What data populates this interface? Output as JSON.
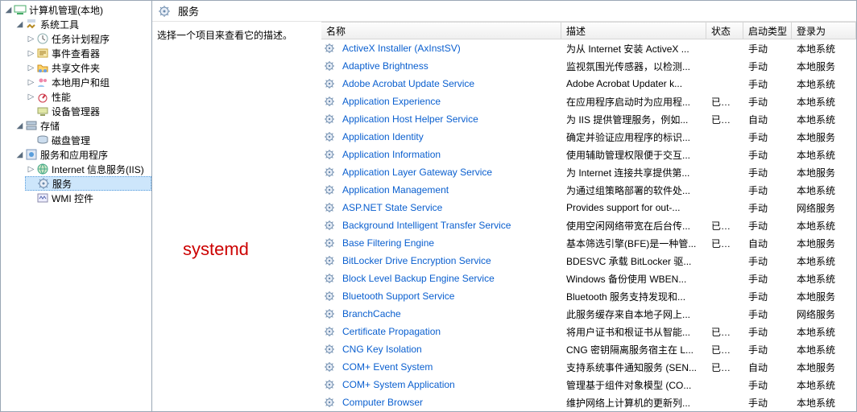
{
  "tree": {
    "root": {
      "label": "计算机管理(本地)"
    },
    "sysTools": {
      "label": "系统工具"
    },
    "taskSched": {
      "label": "任务计划程序"
    },
    "eventViewer": {
      "label": "事件查看器"
    },
    "sharedFold": {
      "label": "共享文件夹"
    },
    "localUsers": {
      "label": "本地用户和组"
    },
    "perf": {
      "label": "性能"
    },
    "devMgr": {
      "label": "设备管理器"
    },
    "storage": {
      "label": "存储"
    },
    "diskMgmt": {
      "label": "磁盘管理"
    },
    "svcApps": {
      "label": "服务和应用程序"
    },
    "iis": {
      "label": "Internet 信息服务(IIS)"
    },
    "services": {
      "label": "服务"
    },
    "wmi": {
      "label": "WMI 控件"
    }
  },
  "headerTitle": "服务",
  "detailPrompt": "选择一个项目来查看它的描述。",
  "annotation": "systemd",
  "columns": {
    "name": "名称",
    "desc": "描述",
    "status": "状态",
    "startup": "启动类型",
    "logon": "登录为"
  },
  "services": [
    {
      "name": "ActiveX Installer (AxInstSV)",
      "desc": "为从 Internet 安装 ActiveX ...",
      "status": "",
      "startup": "手动",
      "logon": "本地系统"
    },
    {
      "name": "Adaptive Brightness",
      "desc": "监视氛围光传感器，以检测...",
      "status": "",
      "startup": "手动",
      "logon": "本地服务"
    },
    {
      "name": "Adobe Acrobat Update Service",
      "desc": "Adobe Acrobat Updater k...",
      "status": "",
      "startup": "手动",
      "logon": "本地系统"
    },
    {
      "name": "Application Experience",
      "desc": "在应用程序启动时为应用程...",
      "status": "已启动",
      "startup": "手动",
      "logon": "本地系统"
    },
    {
      "name": "Application Host Helper Service",
      "desc": "为 IIS 提供管理服务，例如...",
      "status": "已启动",
      "startup": "自动",
      "logon": "本地系统"
    },
    {
      "name": "Application Identity",
      "desc": "确定并验证应用程序的标识...",
      "status": "",
      "startup": "手动",
      "logon": "本地服务"
    },
    {
      "name": "Application Information",
      "desc": "使用辅助管理权限便于交互...",
      "status": "",
      "startup": "手动",
      "logon": "本地系统"
    },
    {
      "name": "Application Layer Gateway Service",
      "desc": "为 Internet 连接共享提供第...",
      "status": "",
      "startup": "手动",
      "logon": "本地服务"
    },
    {
      "name": "Application Management",
      "desc": "为通过组策略部署的软件处...",
      "status": "",
      "startup": "手动",
      "logon": "本地系统"
    },
    {
      "name": "ASP.NET State Service",
      "desc": "Provides support for out-...",
      "status": "",
      "startup": "手动",
      "logon": "网络服务"
    },
    {
      "name": "Background Intelligent Transfer Service",
      "desc": "使用空闲网络带宽在后台传...",
      "status": "已启动",
      "startup": "手动",
      "logon": "本地系统"
    },
    {
      "name": "Base Filtering Engine",
      "desc": "基本筛选引擎(BFE)是一种管...",
      "status": "已启动",
      "startup": "自动",
      "logon": "本地服务"
    },
    {
      "name": "BitLocker Drive Encryption Service",
      "desc": "BDESVC 承载 BitLocker 驱...",
      "status": "",
      "startup": "手动",
      "logon": "本地系统"
    },
    {
      "name": "Block Level Backup Engine Service",
      "desc": "Windows 备份使用 WBEN...",
      "status": "",
      "startup": "手动",
      "logon": "本地系统"
    },
    {
      "name": "Bluetooth Support Service",
      "desc": "Bluetooth 服务支持发现和...",
      "status": "",
      "startup": "手动",
      "logon": "本地服务"
    },
    {
      "name": "BranchCache",
      "desc": "此服务缓存来自本地子网上...",
      "status": "",
      "startup": "手动",
      "logon": "网络服务"
    },
    {
      "name": "Certificate Propagation",
      "desc": "将用户证书和根证书从智能...",
      "status": "已启动",
      "startup": "手动",
      "logon": "本地系统"
    },
    {
      "name": "CNG Key Isolation",
      "desc": "CNG 密钥隔离服务宿主在 L...",
      "status": "已启动",
      "startup": "手动",
      "logon": "本地系统"
    },
    {
      "name": "COM+ Event System",
      "desc": "支持系统事件通知服务 (SEN...",
      "status": "已启动",
      "startup": "自动",
      "logon": "本地服务"
    },
    {
      "name": "COM+ System Application",
      "desc": "管理基于组件对象模型 (CO...",
      "status": "",
      "startup": "手动",
      "logon": "本地系统"
    },
    {
      "name": "Computer Browser",
      "desc": "维护网络上计算机的更新列...",
      "status": "",
      "startup": "手动",
      "logon": "本地系统"
    }
  ]
}
